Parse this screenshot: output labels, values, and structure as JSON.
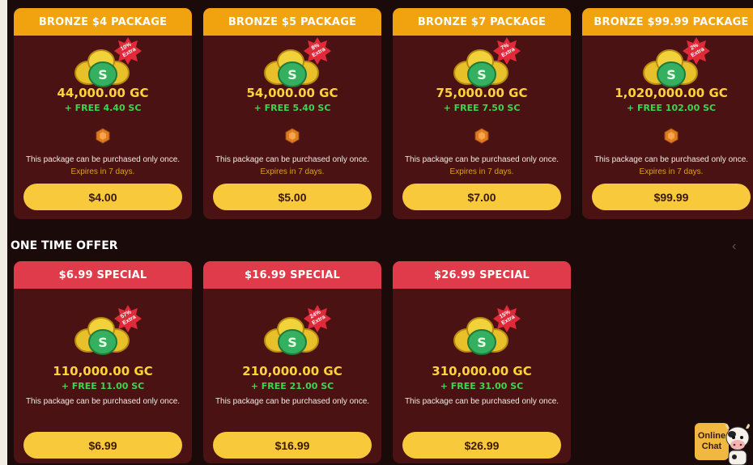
{
  "packages": [
    {
      "title": "BRONZE $4 PACKAGE",
      "badge_pct": "10%",
      "badge_label": "Extra",
      "gc": "44,000.00 GC",
      "sc": "+ FREE 4.40 SC",
      "note": "This package can be purchased only once.",
      "expires": "Expires in 7 days.",
      "price": "$4.00"
    },
    {
      "title": "BRONZE $5 PACKAGE",
      "badge_pct": "8%",
      "badge_label": "Extra",
      "gc": "54,000.00 GC",
      "sc": "+ FREE 5.40 SC",
      "note": "This package can be purchased only once.",
      "expires": "Expires in 7 days.",
      "price": "$5.00"
    },
    {
      "title": "BRONZE $7 PACKAGE",
      "badge_pct": "7%",
      "badge_label": "Extra",
      "gc": "75,000.00 GC",
      "sc": "+ FREE 7.50 SC",
      "note": "This package can be purchased only once.",
      "expires": "Expires in 7 days.",
      "price": "$7.00"
    },
    {
      "title": "BRONZE $99.99 PACKAGE",
      "badge_pct": "2%",
      "badge_label": "Extra",
      "gc": "1,020,000.00 GC",
      "sc": "+ FREE 102.00 SC",
      "note": "This package can be purchased only once.",
      "expires": "Expires in 7 days.",
      "price": "$99.99"
    }
  ],
  "one_time_offer": {
    "title": "ONE TIME OFFER",
    "items": [
      {
        "title": "$6.99 SPECIAL",
        "badge_pct": "57%",
        "badge_label": "Extra",
        "gc": "110,000.00 GC",
        "sc": "+ FREE 11.00 SC",
        "note": "This package can be purchased only once.",
        "price": "$6.99"
      },
      {
        "title": "$16.99 SPECIAL",
        "badge_pct": "24%",
        "badge_label": "Extra",
        "gc": "210,000.00 GC",
        "sc": "+ FREE 21.00 SC",
        "note": "This package can be purchased only once.",
        "price": "$16.99"
      },
      {
        "title": "$26.99 SPECIAL",
        "badge_pct": "15%",
        "badge_label": "Extra",
        "gc": "310,000.00 GC",
        "sc": "+ FREE 31.00 SC",
        "note": "This package can be purchased only once.",
        "price": "$26.99"
      }
    ]
  },
  "chevron": "‹",
  "chat": {
    "line1": "Online",
    "line2": "Chat"
  },
  "colors": {
    "header_gold": "#f0a30e",
    "header_red": "#e03b4a",
    "card_bg": "#4a1212",
    "button": "#f8c93a",
    "gc_text": "#ffd23a",
    "sc_text": "#3fd44f",
    "expires_text": "#e0a021"
  },
  "icons": {
    "coins": "coin-pile-icon",
    "badge": "starburst-badge-icon",
    "gem": "bronze-gem-icon",
    "chevron": "chevron-left-icon",
    "mascot": "cow-mascot-icon"
  }
}
